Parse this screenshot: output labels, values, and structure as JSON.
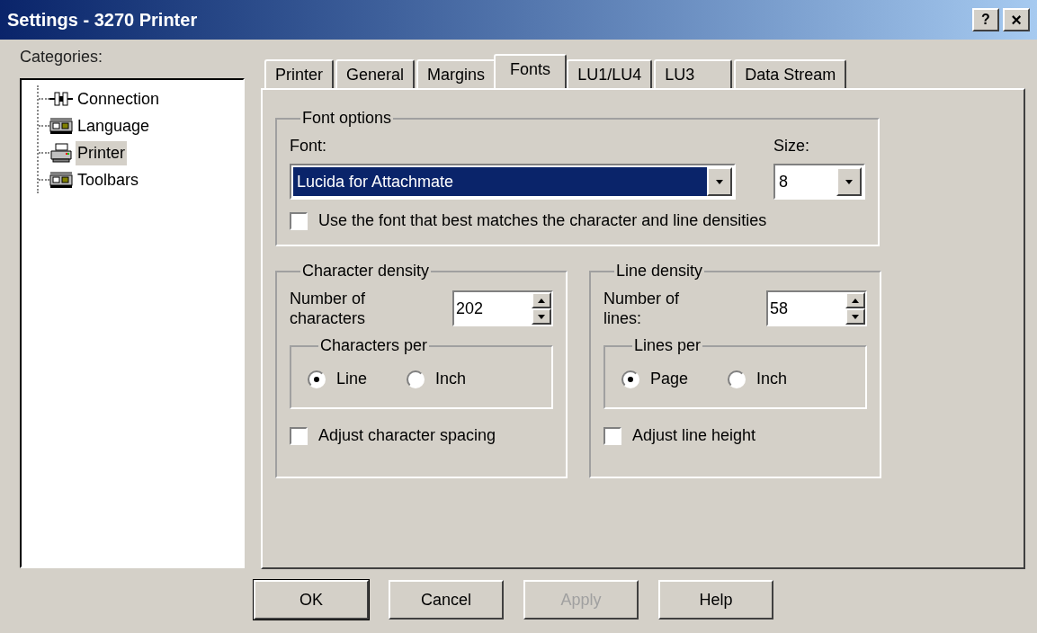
{
  "window": {
    "title": "Settings - 3270 Printer",
    "help_button": "?",
    "close_button": "×"
  },
  "categories": {
    "label": "Categories:",
    "items": [
      {
        "label": "Connection",
        "kind": "connector",
        "selected": false
      },
      {
        "label": "Language",
        "kind": "panel",
        "selected": false
      },
      {
        "label": "Printer",
        "kind": "printer",
        "selected": true
      },
      {
        "label": "Toolbars",
        "kind": "panel",
        "selected": false
      }
    ]
  },
  "tabs": [
    {
      "label": "Printer",
      "selected": false
    },
    {
      "label": "General",
      "selected": false
    },
    {
      "label": "Margins",
      "selected": false
    },
    {
      "label": "Fonts",
      "selected": true
    },
    {
      "label": "LU1/LU4",
      "selected": false
    },
    {
      "label": "LU3",
      "selected": false
    },
    {
      "label": "Data Stream",
      "selected": false
    }
  ],
  "font_options": {
    "title": "Font options",
    "font_label": "Font:",
    "font_value": "Lucida for Attachmate",
    "size_label": "Size:",
    "size_value": "8",
    "best_match": {
      "label": "Use the font that best matches the character and line densities",
      "checked": false
    }
  },
  "densities": [
    {
      "title": "Character density",
      "number_label": "Number of characters",
      "number_value": "202",
      "per_title": "Characters per",
      "options": [
        {
          "label": "Line",
          "selected": true
        },
        {
          "label": "Inch",
          "selected": false
        }
      ],
      "adjust": {
        "label": "Adjust character spacing",
        "checked": false
      }
    },
    {
      "title": "Line density",
      "number_label": "Number of lines:",
      "number_value": "58",
      "per_title": "Lines per",
      "options": [
        {
          "label": "Page",
          "selected": true
        },
        {
          "label": "Inch",
          "selected": false
        }
      ],
      "adjust": {
        "label": "Adjust line height",
        "checked": false
      }
    }
  ],
  "buttons": [
    {
      "label": "OK",
      "default": true,
      "disabled": false
    },
    {
      "label": "Cancel",
      "default": false,
      "disabled": false
    },
    {
      "label": "Apply",
      "default": false,
      "disabled": true
    },
    {
      "label": "Help",
      "default": false,
      "disabled": false
    }
  ]
}
